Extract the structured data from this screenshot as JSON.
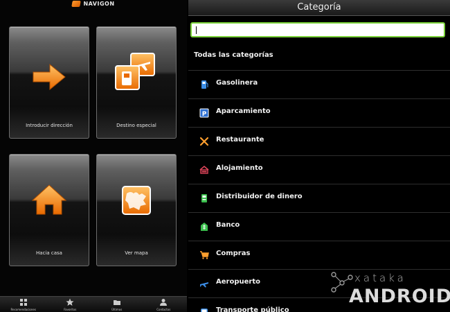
{
  "left_panel": {
    "logo_text": "NAVIGON",
    "tiles": [
      {
        "label": "Introducir dirección",
        "icon": "arrow-right-icon"
      },
      {
        "label": "Destino especial",
        "icon": "poi-airplane-icon"
      },
      {
        "label": "Hacia casa",
        "icon": "home-icon"
      },
      {
        "label": "Ver mapa",
        "icon": "map-icon"
      }
    ],
    "bottom_nav": [
      {
        "label": "Recomendaciones",
        "icon": "grid-icon"
      },
      {
        "label": "Favoritos",
        "icon": "star-icon"
      },
      {
        "label": "Últimos",
        "icon": "folder-icon"
      },
      {
        "label": "Contactos",
        "icon": "person-icon"
      }
    ]
  },
  "right_panel": {
    "title": "Categoría",
    "search_value": "",
    "all_categories_label": "Todas las categorías",
    "categories": [
      {
        "label": "Gasolinera",
        "icon": "fuel-icon",
        "color": "#3b8de6"
      },
      {
        "label": "Aparcamiento",
        "icon": "parking-icon",
        "color": "#2d6fd1"
      },
      {
        "label": "Restaurante",
        "icon": "restaurant-icon",
        "color": "#ff9f2e"
      },
      {
        "label": "Alojamiento",
        "icon": "hotel-icon",
        "color": "#e0455a"
      },
      {
        "label": "Distribuidor de dinero",
        "icon": "atm-icon",
        "color": "#3bbf4d"
      },
      {
        "label": "Banco",
        "icon": "bank-icon",
        "color": "#3bbf4d"
      },
      {
        "label": "Compras",
        "icon": "shopping-cart-icon",
        "color": "#ff9f2e"
      },
      {
        "label": "Aeropuerto",
        "icon": "airplane-icon",
        "color": "#3b8de6"
      },
      {
        "label": "Transporte público",
        "icon": "bus-icon",
        "color": "#3b8de6"
      }
    ]
  },
  "watermark": {
    "top": "xataka",
    "bottom": "ANDROID"
  },
  "colors": {
    "accent_orange": "#ff9a2e",
    "search_border": "#7bd23a"
  }
}
